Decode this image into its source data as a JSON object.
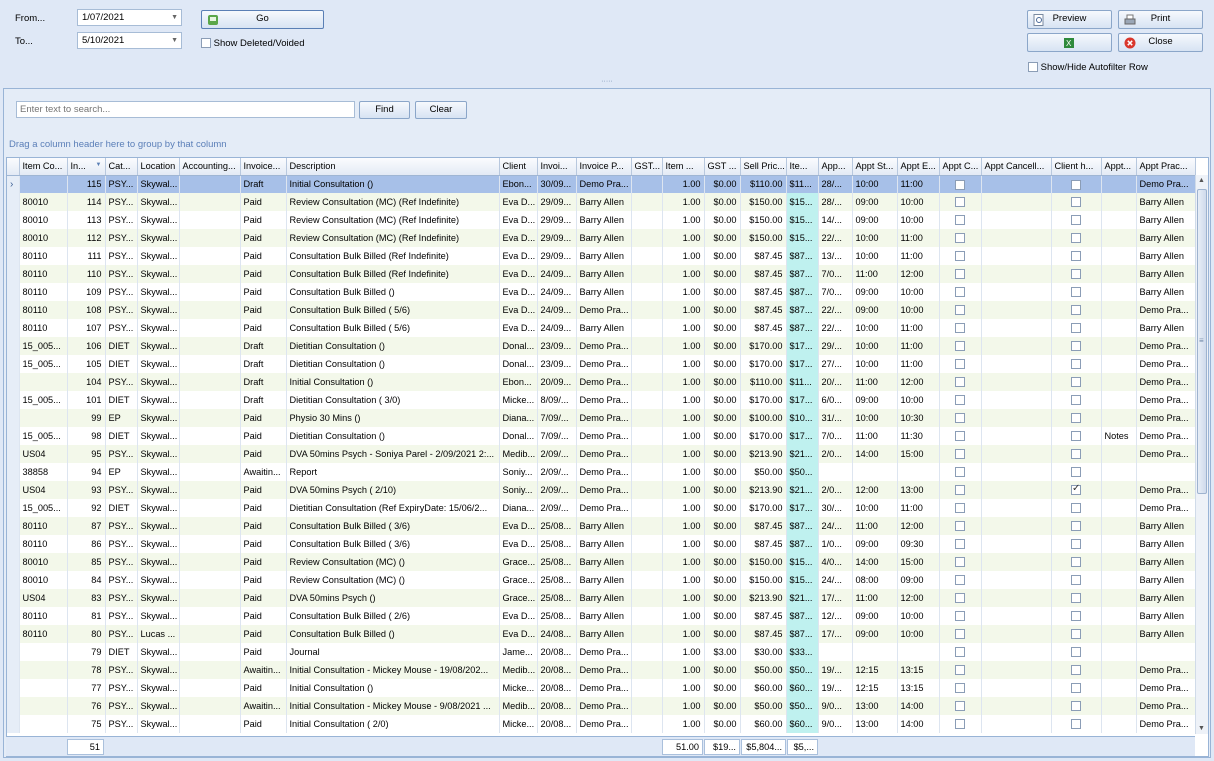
{
  "filter": {
    "from_label": "From...",
    "from_value": "1/07/2021",
    "to_label": "To...",
    "to_value": "5/10/2021",
    "go_label": "Go",
    "show_deleted_label": "Show Deleted/Voided"
  },
  "actions": {
    "preview_label": "Preview",
    "print_label": "Print",
    "close_label": "Close",
    "autofilter_label": "Show/Hide Autofilter Row"
  },
  "search": {
    "placeholder": "Enter text to search...",
    "find_label": "Find",
    "clear_label": "Clear"
  },
  "group_hint": "Drag a column header here to group by that column",
  "columns": [
    "Item Co...",
    "In...",
    "Cat...",
    "Location",
    "Accounting...",
    "Invoice...",
    "Description",
    "Client",
    "Invoi...",
    "Invoice P...",
    "GST...",
    "Item ...",
    "GST ...",
    "Sell Pric...",
    "Ite...",
    "App...",
    "Appt St...",
    "Appt E...",
    "Appt C...",
    "Appt Cancell...",
    "Client h...",
    "Appt...",
    "Appt Prac..."
  ],
  "rows": [
    [
      "",
      "115",
      "PSY...",
      "Skywal...",
      "",
      "Draft",
      "Initial Consultation ()",
      "Ebon...",
      "30/09...",
      "Demo Pra...",
      "",
      "1.00",
      "$0.00",
      "$110.00",
      "$11...",
      "28/...",
      "10:00",
      "11:00",
      "",
      "",
      "",
      "",
      "Demo Pra..."
    ],
    [
      "80010",
      "114",
      "PSY...",
      "Skywal...",
      "",
      "Paid",
      "Review Consultation (MC) (Ref Indefinite)",
      "Eva D...",
      "29/09...",
      "Barry Allen",
      "",
      "1.00",
      "$0.00",
      "$150.00",
      "$15...",
      "28/...",
      "09:00",
      "10:00",
      "",
      "",
      "",
      "",
      "Barry Allen"
    ],
    [
      "80010",
      "113",
      "PSY...",
      "Skywal...",
      "",
      "Paid",
      "Review Consultation (MC) (Ref Indefinite)",
      "Eva D...",
      "29/09...",
      "Barry Allen",
      "",
      "1.00",
      "$0.00",
      "$150.00",
      "$15...",
      "14/...",
      "09:00",
      "10:00",
      "",
      "",
      "",
      "",
      "Barry Allen"
    ],
    [
      "80010",
      "112",
      "PSY...",
      "Skywal...",
      "",
      "Paid",
      "Review Consultation (MC) (Ref Indefinite)",
      "Eva D...",
      "29/09...",
      "Barry Allen",
      "",
      "1.00",
      "$0.00",
      "$150.00",
      "$15...",
      "22/...",
      "10:00",
      "11:00",
      "",
      "",
      "",
      "",
      "Barry Allen"
    ],
    [
      "80110",
      "111",
      "PSY...",
      "Skywal...",
      "",
      "Paid",
      "Consultation Bulk Billed (Ref Indefinite)",
      "Eva D...",
      "29/09...",
      "Barry Allen",
      "",
      "1.00",
      "$0.00",
      "$87.45",
      "$87...",
      "13/...",
      "10:00",
      "11:00",
      "",
      "",
      "",
      "",
      "Barry Allen"
    ],
    [
      "80110",
      "110",
      "PSY...",
      "Skywal...",
      "",
      "Paid",
      "Consultation Bulk Billed (Ref Indefinite)",
      "Eva D...",
      "24/09...",
      "Barry Allen",
      "",
      "1.00",
      "$0.00",
      "$87.45",
      "$87...",
      "7/0...",
      "11:00",
      "12:00",
      "",
      "",
      "",
      "",
      "Barry Allen"
    ],
    [
      "80110",
      "109",
      "PSY...",
      "Skywal...",
      "",
      "Paid",
      "Consultation Bulk Billed ()",
      "Eva D...",
      "24/09...",
      "Barry Allen",
      "",
      "1.00",
      "$0.00",
      "$87.45",
      "$87...",
      "7/0...",
      "09:00",
      "10:00",
      "",
      "",
      "",
      "",
      "Barry Allen"
    ],
    [
      "80110",
      "108",
      "PSY...",
      "Skywal...",
      "",
      "Paid",
      "Consultation Bulk Billed ( 5/6)",
      "Eva D...",
      "24/09...",
      "Demo Pra...",
      "",
      "1.00",
      "$0.00",
      "$87.45",
      "$87...",
      "22/...",
      "09:00",
      "10:00",
      "",
      "",
      "",
      "",
      "Demo Pra..."
    ],
    [
      "80110",
      "107",
      "PSY...",
      "Skywal...",
      "",
      "Paid",
      "Consultation Bulk Billed ( 5/6)",
      "Eva D...",
      "24/09...",
      "Barry Allen",
      "",
      "1.00",
      "$0.00",
      "$87.45",
      "$87...",
      "22/...",
      "10:00",
      "11:00",
      "",
      "",
      "",
      "",
      "Barry Allen"
    ],
    [
      "15_005...",
      "106",
      "DIET",
      "Skywal...",
      "",
      "Draft",
      "Dietitian Consultation ()",
      "Donal...",
      "23/09...",
      "Demo Pra...",
      "",
      "1.00",
      "$0.00",
      "$170.00",
      "$17...",
      "29/...",
      "10:00",
      "11:00",
      "",
      "",
      "",
      "",
      "Demo Pra..."
    ],
    [
      "15_005...",
      "105",
      "DIET",
      "Skywal...",
      "",
      "Draft",
      "Dietitian Consultation ()",
      "Donal...",
      "23/09...",
      "Demo Pra...",
      "",
      "1.00",
      "$0.00",
      "$170.00",
      "$17...",
      "27/...",
      "10:00",
      "11:00",
      "",
      "",
      "",
      "",
      "Demo Pra..."
    ],
    [
      "",
      "104",
      "PSY...",
      "Skywal...",
      "",
      "Draft",
      "Initial Consultation ()",
      "Ebon...",
      "20/09...",
      "Demo Pra...",
      "",
      "1.00",
      "$0.00",
      "$110.00",
      "$11...",
      "20/...",
      "11:00",
      "12:00",
      "",
      "",
      "",
      "",
      "Demo Pra..."
    ],
    [
      "15_005...",
      "101",
      "DIET",
      "Skywal...",
      "",
      "Draft",
      "Dietitian Consultation ( 3/0)",
      "Micke...",
      "8/09/...",
      "Demo Pra...",
      "",
      "1.00",
      "$0.00",
      "$170.00",
      "$17...",
      "6/0...",
      "09:00",
      "10:00",
      "",
      "",
      "",
      "",
      "Demo Pra..."
    ],
    [
      "",
      "99",
      "EP",
      "Skywal...",
      "",
      "Paid",
      "Physio 30 Mins ()",
      "Diana...",
      "7/09/...",
      "Demo Pra...",
      "",
      "1.00",
      "$0.00",
      "$100.00",
      "$10...",
      "31/...",
      "10:00",
      "10:30",
      "",
      "",
      "",
      "",
      "Demo Pra..."
    ],
    [
      "15_005...",
      "98",
      "DIET",
      "Skywal...",
      "",
      "Paid",
      "Dietitian Consultation ()",
      "Donal...",
      "7/09/...",
      "Demo Pra...",
      "",
      "1.00",
      "$0.00",
      "$170.00",
      "$17...",
      "7/0...",
      "11:00",
      "11:30",
      "",
      "",
      "",
      "Notes",
      "Demo Pra..."
    ],
    [
      "US04",
      "95",
      "PSY...",
      "Skywal...",
      "",
      "Paid",
      "DVA 50mins Psych - Soniya Parel - 2/09/2021 2:...",
      "Medib...",
      "2/09/...",
      "Demo Pra...",
      "",
      "1.00",
      "$0.00",
      "$213.90",
      "$21...",
      "2/0...",
      "14:00",
      "15:00",
      "",
      "",
      "",
      "",
      "Demo Pra..."
    ],
    [
      "38858",
      "94",
      "EP",
      "Skywal...",
      "",
      "Awaitin...",
      "Report",
      "Soniy...",
      "2/09/...",
      "Demo Pra...",
      "",
      "1.00",
      "$0.00",
      "$50.00",
      "$50...",
      "",
      "",
      "",
      "",
      "",
      "",
      "",
      ""
    ],
    [
      "US04",
      "93",
      "PSY...",
      "Skywal...",
      "",
      "Paid",
      "DVA 50mins Psych ( 2/10)",
      "Soniy...",
      "2/09/...",
      "Demo Pra...",
      "",
      "1.00",
      "$0.00",
      "$213.90",
      "$21...",
      "2/0...",
      "12:00",
      "13:00",
      "",
      "",
      "checked",
      "",
      "Demo Pra..."
    ],
    [
      "15_005...",
      "92",
      "DIET",
      "Skywal...",
      "",
      "Paid",
      "Dietitian Consultation (Ref ExpiryDate: 15/06/2...",
      "Diana...",
      "2/09/...",
      "Demo Pra...",
      "",
      "1.00",
      "$0.00",
      "$170.00",
      "$17...",
      "30/...",
      "10:00",
      "11:00",
      "",
      "",
      "",
      "",
      "Demo Pra..."
    ],
    [
      "80110",
      "87",
      "PSY...",
      "Skywal...",
      "",
      "Paid",
      "Consultation Bulk Billed ( 3/6)",
      "Eva D...",
      "25/08...",
      "Barry Allen",
      "",
      "1.00",
      "$0.00",
      "$87.45",
      "$87...",
      "24/...",
      "11:00",
      "12:00",
      "",
      "",
      "",
      "",
      "Barry Allen"
    ],
    [
      "80110",
      "86",
      "PSY...",
      "Skywal...",
      "",
      "Paid",
      "Consultation Bulk Billed ( 3/6)",
      "Eva D...",
      "25/08...",
      "Barry Allen",
      "",
      "1.00",
      "$0.00",
      "$87.45",
      "$87...",
      "1/0...",
      "09:00",
      "09:30",
      "",
      "",
      "",
      "",
      "Barry Allen"
    ],
    [
      "80010",
      "85",
      "PSY...",
      "Skywal...",
      "",
      "Paid",
      "Review Consultation (MC) ()",
      "Grace...",
      "25/08...",
      "Barry Allen",
      "",
      "1.00",
      "$0.00",
      "$150.00",
      "$15...",
      "4/0...",
      "14:00",
      "15:00",
      "",
      "",
      "",
      "",
      "Barry Allen"
    ],
    [
      "80010",
      "84",
      "PSY...",
      "Skywal...",
      "",
      "Paid",
      "Review Consultation (MC) ()",
      "Grace...",
      "25/08...",
      "Barry Allen",
      "",
      "1.00",
      "$0.00",
      "$150.00",
      "$15...",
      "24/...",
      "08:00",
      "09:00",
      "",
      "",
      "",
      "",
      "Barry Allen"
    ],
    [
      "US04",
      "83",
      "PSY...",
      "Skywal...",
      "",
      "Paid",
      "DVA 50mins Psych ()",
      "Grace...",
      "25/08...",
      "Barry Allen",
      "",
      "1.00",
      "$0.00",
      "$213.90",
      "$21...",
      "17/...",
      "11:00",
      "12:00",
      "",
      "",
      "",
      "",
      "Barry Allen"
    ],
    [
      "80110",
      "81",
      "PSY...",
      "Skywal...",
      "",
      "Paid",
      "Consultation Bulk Billed ( 2/6)",
      "Eva D...",
      "25/08...",
      "Barry Allen",
      "",
      "1.00",
      "$0.00",
      "$87.45",
      "$87...",
      "12/...",
      "09:00",
      "10:00",
      "",
      "",
      "",
      "",
      "Barry Allen"
    ],
    [
      "80110",
      "80",
      "PSY...",
      "Lucas ...",
      "",
      "Paid",
      "Consultation Bulk Billed ()",
      "Eva D...",
      "24/08...",
      "Barry Allen",
      "",
      "1.00",
      "$0.00",
      "$87.45",
      "$87...",
      "17/...",
      "09:00",
      "10:00",
      "",
      "",
      "",
      "",
      "Barry Allen"
    ],
    [
      "",
      "79",
      "DIET",
      "Skywal...",
      "",
      "Paid",
      "Journal",
      "Jame...",
      "20/08...",
      "Demo Pra...",
      "",
      "1.00",
      "$3.00",
      "$30.00",
      "$33...",
      "",
      "",
      "",
      "",
      "",
      "",
      "",
      ""
    ],
    [
      "",
      "78",
      "PSY...",
      "Skywal...",
      "",
      "Awaitin...",
      "Initial Consultation - Mickey Mouse - 19/08/202...",
      "Medib...",
      "20/08...",
      "Demo Pra...",
      "",
      "1.00",
      "$0.00",
      "$50.00",
      "$50...",
      "19/...",
      "12:15",
      "13:15",
      "",
      "",
      "",
      "",
      "Demo Pra..."
    ],
    [
      "",
      "77",
      "PSY...",
      "Skywal...",
      "",
      "Paid",
      "Initial Consultation ()",
      "Micke...",
      "20/08...",
      "Demo Pra...",
      "",
      "1.00",
      "$0.00",
      "$60.00",
      "$60...",
      "19/...",
      "12:15",
      "13:15",
      "",
      "",
      "",
      "",
      "Demo Pra..."
    ],
    [
      "",
      "76",
      "PSY...",
      "Skywal...",
      "",
      "Awaitin...",
      "Initial Consultation - Mickey Mouse - 9/08/2021 ...",
      "Medib...",
      "20/08...",
      "Demo Pra...",
      "",
      "1.00",
      "$0.00",
      "$50.00",
      "$50...",
      "9/0...",
      "13:00",
      "14:00",
      "",
      "",
      "",
      "",
      "Demo Pra..."
    ],
    [
      "",
      "75",
      "PSY...",
      "Skywal...",
      "",
      "Paid",
      "Initial Consultation ( 2/0)",
      "Micke...",
      "20/08...",
      "Demo Pra...",
      "",
      "1.00",
      "$0.00",
      "$60.00",
      "$60...",
      "9/0...",
      "13:00",
      "14:00",
      "",
      "",
      "",
      "",
      "Demo Pra..."
    ]
  ],
  "footer": {
    "count": "51",
    "qty_total": "51.00",
    "gst_total": "$19...",
    "sell_total": "$5,804...",
    "item_total": "$5,..."
  }
}
